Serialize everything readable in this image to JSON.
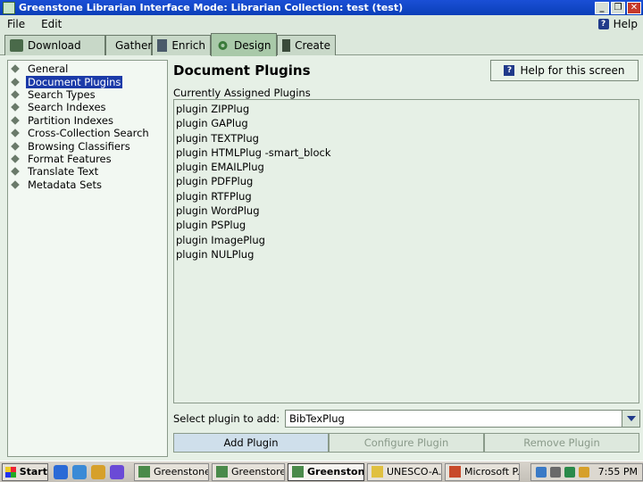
{
  "window": {
    "title": "Greenstone Librarian Interface  Mode: Librarian  Collection: test (test)"
  },
  "menu": {
    "file": "File",
    "edit": "Edit",
    "help": "Help"
  },
  "tabs": [
    {
      "label": "Download",
      "icon": "download-icon"
    },
    {
      "label": "Gather",
      "icon": "gather-icon"
    },
    {
      "label": "Enrich",
      "icon": "enrich-icon"
    },
    {
      "label": "Design",
      "icon": "gear-icon"
    },
    {
      "label": "Create",
      "icon": "create-icon"
    }
  ],
  "nav": {
    "items": [
      "General",
      "Document Plugins",
      "Search Types",
      "Search Indexes",
      "Partition Indexes",
      "Cross-Collection Search",
      "Browsing Classifiers",
      "Format Features",
      "Translate Text",
      "Metadata Sets"
    ],
    "selected": "Document Plugins"
  },
  "main": {
    "title": "Document Plugins",
    "help_button": "Help for this screen",
    "assigned_label": "Currently Assigned Plugins",
    "plugins": [
      "plugin ZIPPlug",
      "plugin GAPlug",
      "plugin TEXTPlug",
      "plugin HTMLPlug -smart_block",
      "plugin EMAILPlug",
      "plugin PDFPlug",
      "plugin RTFPlug",
      "plugin WordPlug",
      "plugin PSPlug",
      "plugin ImagePlug",
      "plugin NULPlug"
    ],
    "select_label": "Select plugin to add:",
    "select_value": "BibTexPlug",
    "buttons": {
      "add": "Add Plugin",
      "configure": "Configure Plugin",
      "remove": "Remove Plugin"
    }
  },
  "taskbar": {
    "start": "Start",
    "tasks": [
      {
        "label": "Greenstone ...",
        "active": false
      },
      {
        "label": "Greenstore...",
        "active": false
      },
      {
        "label": "Greenston...",
        "active": true
      },
      {
        "label": "UNESCO-A...",
        "active": false
      },
      {
        "label": "Microsoft P...",
        "active": false
      }
    ],
    "clock": "7:55 PM"
  },
  "colors": {
    "title_bar": "#0a3fb8",
    "selection": "#1b3aa8",
    "panel_bg": "#e6f0e6",
    "active_tab": "#a9c9a9"
  }
}
